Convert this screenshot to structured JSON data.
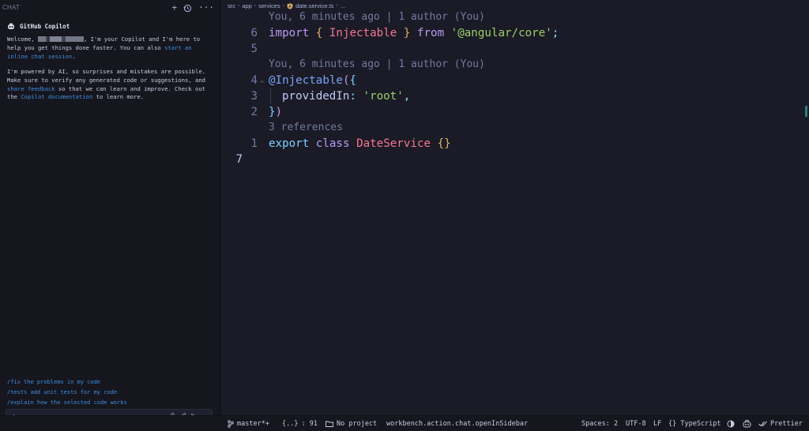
{
  "sidebar": {
    "title": "CHAT",
    "actions": {
      "new": "+",
      "history": "history-icon",
      "more": "···"
    },
    "copilot_name": "GitHub Copilot",
    "welcome_pre": "Welcome, ",
    "welcome_post": ", I'm your Copilot and I'm here to help you get things done faster. You can also ",
    "welcome_link": "start an inline chat session",
    "welcome_end": ".",
    "disclaimer_pre": "I'm powered by AI, so surprises and mistakes are possible. Make sure to verify any generated code or suggestions, and ",
    "disclaimer_link1": "share feedback",
    "disclaimer_mid": " so that we can learn and improve. Check out the ",
    "disclaimer_link2": "Copilot documentation",
    "disclaimer_end": " to learn more.",
    "suggestions": [
      "/fix the problems in my code",
      "/tests add unit tests for my code",
      "/explain how the selected code works"
    ],
    "input_value": "/"
  },
  "editor": {
    "breadcrumb": [
      "src",
      "app",
      "services",
      "date.service.ts",
      "…"
    ],
    "lens_author": "You, 6 minutes ago | 1 author (You)",
    "lens_refs": "3 references",
    "line_numbers": [
      "6",
      "5",
      "4",
      "3",
      "2",
      "1",
      "7"
    ],
    "code": {
      "import": "import",
      "open_brace": "{",
      "injectable_name": "Injectable",
      "close_brace": "}",
      "from": "from",
      "module": "'@angular/core'",
      "semi": ";",
      "decorator": "@Injectable",
      "paren_open": "(",
      "obj_open": "{",
      "prop": "providedIn",
      "colon": ": ",
      "root": "'root'",
      "comma": ",",
      "obj_close": "}",
      "paren_close": ")",
      "export": "export",
      "class": "class",
      "class_name": "DateService",
      "empty_body": "{}"
    }
  },
  "statusbar": {
    "branch": "master*+",
    "braces": "{..}",
    "col": ": 91",
    "project": "No project",
    "command": "workbench.action.chat.openInSidebar",
    "spaces": "Spaces: 2",
    "encoding": "UTF-8",
    "eol": "LF",
    "language": "{} TypeScript",
    "prettier": "Prettier"
  }
}
